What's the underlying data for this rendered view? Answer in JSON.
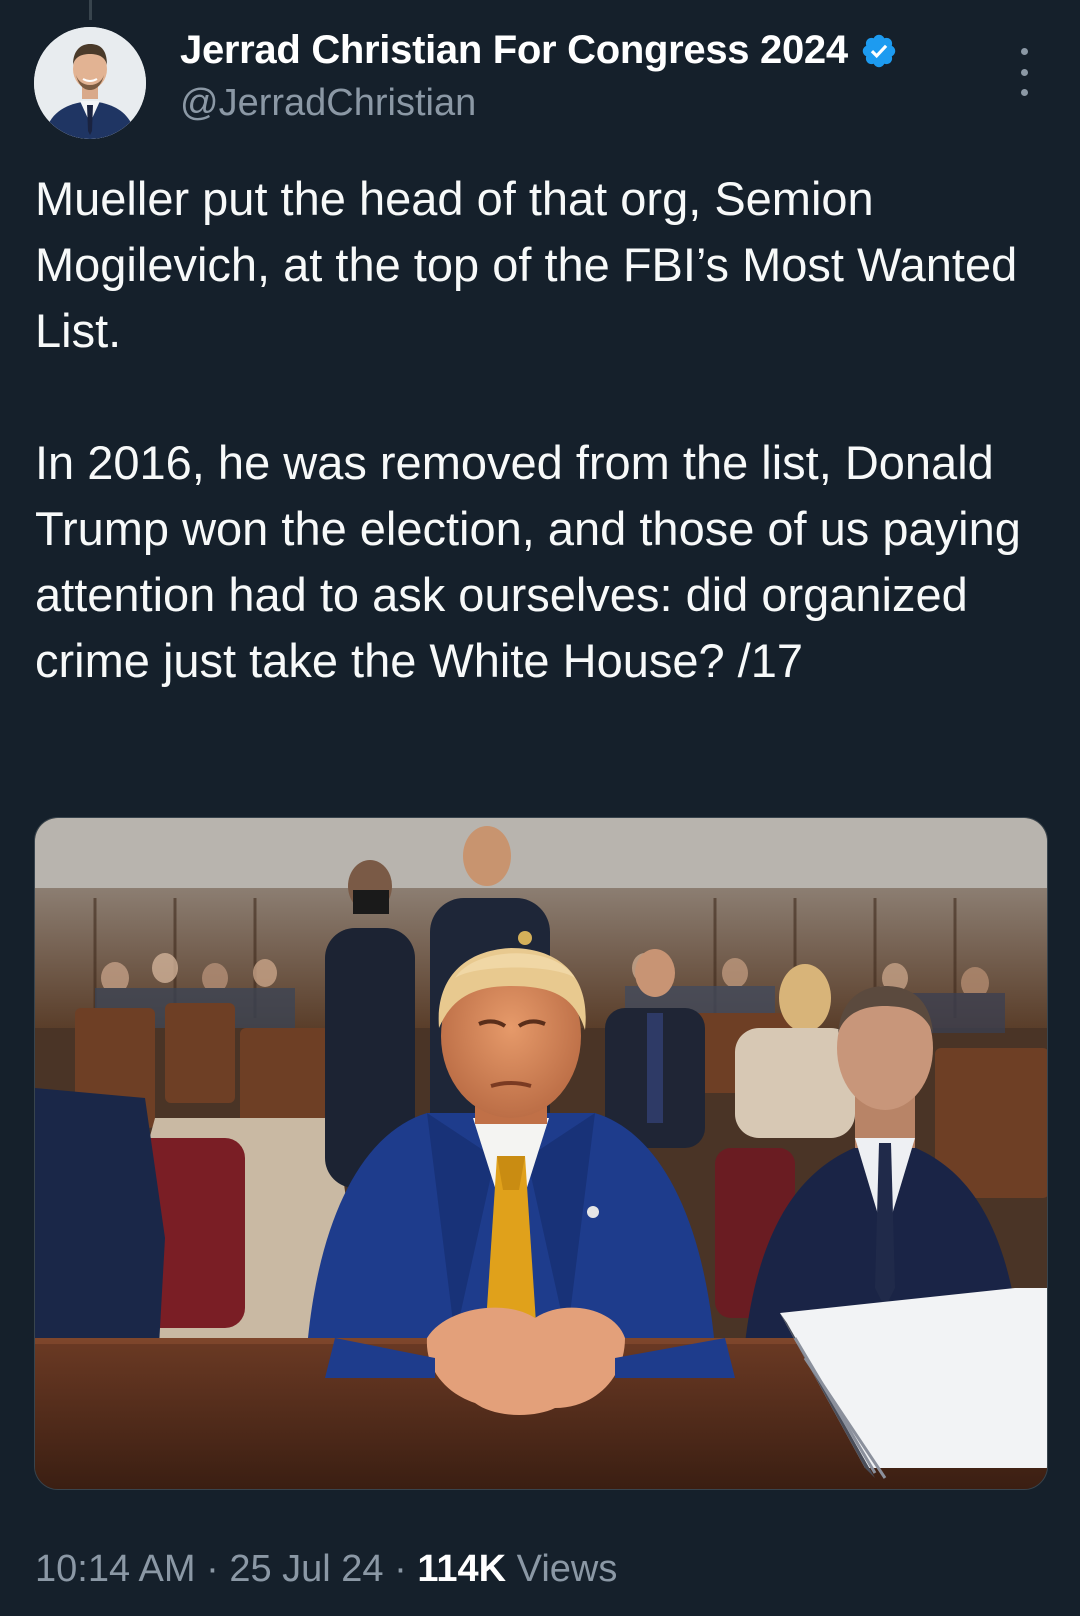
{
  "tweet": {
    "author": {
      "display_name": "Jerrad Christian For Congress 2024",
      "handle": "@JerradChristian",
      "verified": true,
      "avatar_icon": "profile-photo"
    },
    "text": "Mueller put the head of that org, Semion Mogilevich, at the top of the FBI’s Most Wanted List.\n\nIn 2016, he was removed from the list, Donald Trump won the election, and those of us paying attention had to ask ourselves: did organized crime just take the White House? /17",
    "media": {
      "type": "photo"
    },
    "time": "10:14 AM",
    "separator": "·",
    "date": "25 Jul 24",
    "views_count": "114K",
    "views_label": "Views"
  },
  "colors": {
    "background": "#15202B",
    "text_primary": "#FFFFFF",
    "text_secondary": "#8B98A5",
    "verified_badge": "#1D9BF0"
  },
  "icons": [
    "profile-photo",
    "verified-badge-icon",
    "more-options-icon"
  ]
}
